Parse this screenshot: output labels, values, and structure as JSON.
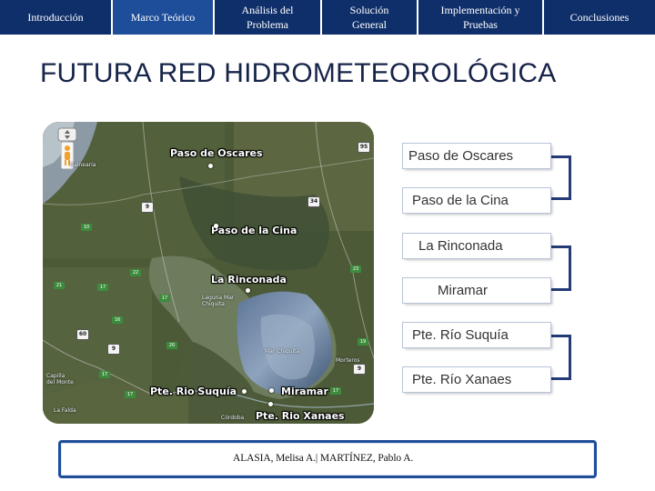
{
  "nav": {
    "tabs": [
      {
        "label": "Introducción"
      },
      {
        "label": "Marco Teórico"
      },
      {
        "label": "Análisis del\nProblema"
      },
      {
        "label": "Solución\nGeneral"
      },
      {
        "label": "Implementación y\nPruebas"
      },
      {
        "label": "Conclusiones"
      }
    ],
    "color": "#0f2f6a"
  },
  "title": "FUTURA RED HIDROMETEOROLÓGICA",
  "map": {
    "labels": {
      "paso_de_oscares": "Paso de Oscares",
      "paso_de_la_cina": "Paso de la Cina",
      "la_rinconada": "La Rinconada",
      "pte_rio_suquia": "Pte. Rio Suquía",
      "miramar": "Miramar",
      "pte_rio_xanaes": "Pte. Rio Xanaes"
    },
    "small_labels": {
      "laguna_mar_chiquita": "Laguna Mar Chiquita",
      "mar_chiquita": "Mar Chiquita",
      "balnearia": "Balnearia",
      "morteros": "Morteros",
      "capilla_del_monte": "Capilla del Monte",
      "la_falda": "La Falda",
      "cordoba": "Córdoba"
    },
    "route_badges": [
      "9",
      "60",
      "9",
      "34",
      "95",
      "9"
    ],
    "green_badges": [
      "22",
      "17",
      "17",
      "21",
      "16",
      "17",
      "20",
      "23",
      "17",
      "19",
      "17",
      "10"
    ]
  },
  "stations": [
    "Paso de Oscares",
    "Paso de la Cina",
    "La Rinconada",
    "Miramar",
    "Pte. Río Suquía",
    "Pte. Río Xanaes"
  ],
  "footer": "ALASIA, Melisa A.| MARTÍNEZ, Pablo A."
}
